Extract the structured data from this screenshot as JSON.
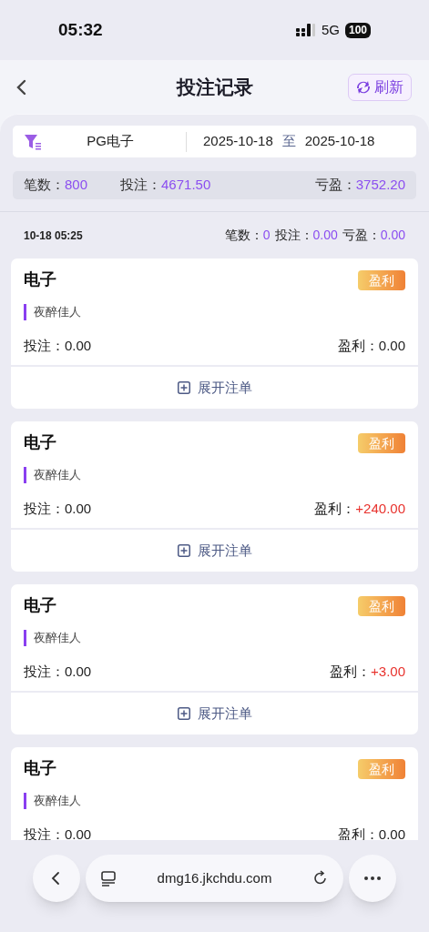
{
  "status_bar": {
    "time": "05:32",
    "network": "5G",
    "battery": "100"
  },
  "header": {
    "title": "投注记录",
    "refresh_label": "刷新"
  },
  "filter": {
    "game": "PG电子",
    "date_from": "2025-10-18",
    "separator": "至",
    "date_to": "2025-10-18"
  },
  "summary": [
    {
      "label": "笔数：",
      "value": "800"
    },
    {
      "label": "投注：",
      "value": "4671.50"
    },
    {
      "label": "亏盈：",
      "value": "3752.20"
    }
  ],
  "group": {
    "time": "10-18 05:25",
    "stats": [
      {
        "label": "笔数：",
        "value": "0"
      },
      {
        "label": "投注：",
        "value": "0.00"
      },
      {
        "label": "亏盈：",
        "value": "0.00"
      }
    ]
  },
  "cards": [
    {
      "title": "电子",
      "badge": "盈利",
      "player": "夜醉佳人",
      "bet_label": "投注：",
      "bet": "0.00",
      "profit_label": "盈利：",
      "profit": "0.00",
      "positive": false,
      "expand_label": "展开注单"
    },
    {
      "title": "电子",
      "badge": "盈利",
      "player": "夜醉佳人",
      "bet_label": "投注：",
      "bet": "0.00",
      "profit_label": "盈利：",
      "profit": "+240.00",
      "positive": true,
      "expand_label": "展开注单"
    },
    {
      "title": "电子",
      "badge": "盈利",
      "player": "夜醉佳人",
      "bet_label": "投注：",
      "bet": "0.00",
      "profit_label": "盈利：",
      "profit": "+3.00",
      "positive": true,
      "expand_label": "展开注单"
    },
    {
      "title": "电子",
      "badge": "盈利",
      "player": "夜醉佳人",
      "bet_label": "投注：",
      "bet": "0.00",
      "profit_label": "盈利：",
      "profit": "0.00",
      "positive": false
    }
  ],
  "browser": {
    "url": "dmg16.jkchdu.com"
  }
}
